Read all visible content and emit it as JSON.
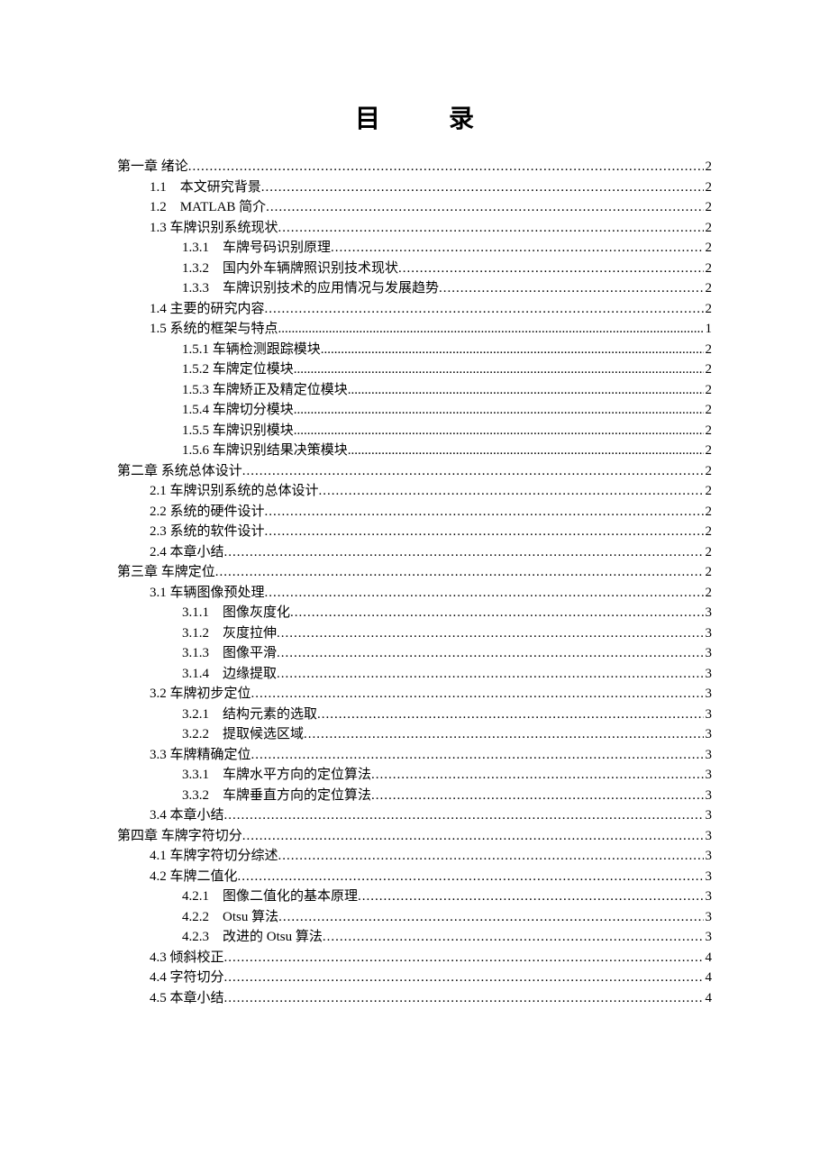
{
  "title": "目　录",
  "entries": [
    {
      "level": 1,
      "label": "第一章  绪论",
      "page": "2",
      "leader": "dots"
    },
    {
      "level": 2,
      "label": "1.1　本文研究背景 ",
      "page": "2",
      "leader": "dots"
    },
    {
      "level": 2,
      "label": "1.2　MATLAB 简介",
      "page": "2",
      "leader": "dots"
    },
    {
      "level": 2,
      "label": "1.3 车牌识别系统现状 ",
      "page": "2",
      "leader": "dots"
    },
    {
      "level": 3,
      "label": "1.3.1　车牌号码识别原理",
      "page": "2",
      "leader": "dots"
    },
    {
      "level": 3,
      "label": "1.3.2　国内外车辆牌照识别技术现状",
      "page": "2",
      "leader": "dots"
    },
    {
      "level": 3,
      "label": "1.3.3　车牌识别技术的应用情况与发展趋势",
      "page": "2",
      "leader": "dots"
    },
    {
      "level": 2,
      "label": "1.4 主要的研究内容 ",
      "page": "2",
      "leader": "dots"
    },
    {
      "level": 2,
      "label": "1.5  系统的框架与特点",
      "page": "1",
      "leader": "thin"
    },
    {
      "level": 3,
      "label": "1.5.1 车辆检测跟踪模块",
      "page": "2",
      "leader": "thin"
    },
    {
      "level": 3,
      "label": "1.5.2 车牌定位模块",
      "page": "2",
      "leader": "thin"
    },
    {
      "level": 3,
      "label": "1.5.3  车牌矫正及精定位模块",
      "page": "2",
      "leader": "thin"
    },
    {
      "level": 3,
      "label": "1.5.4 车牌切分模块",
      "page": "2",
      "leader": "thin"
    },
    {
      "level": 3,
      "label": "1.5.5 车牌识别模块",
      "page": "2",
      "leader": "thin"
    },
    {
      "level": 3,
      "label": "1.5.6 车牌识别结果决策模块",
      "page": "2",
      "leader": "thin"
    },
    {
      "level": 1,
      "label": "第二章  系统总体设计",
      "page": "2",
      "leader": "dots"
    },
    {
      "level": 2,
      "label": "2.1 车牌识别系统的总体设计 ",
      "page": "2",
      "leader": "dots"
    },
    {
      "level": 2,
      "label": "2.2 系统的硬件设计 ",
      "page": "2",
      "leader": "dots"
    },
    {
      "level": 2,
      "label": "2.3 系统的软件设计 ",
      "page": "2",
      "leader": "dots"
    },
    {
      "level": 2,
      "label": "2.4 本章小结 ",
      "page": "2",
      "leader": "dots"
    },
    {
      "level": 1,
      "label": "第三章  车牌定位",
      "page": "2",
      "leader": "dots"
    },
    {
      "level": 2,
      "label": "3.1 车辆图像预处理 ",
      "page": "2",
      "leader": "dots"
    },
    {
      "level": 3,
      "label": "3.1.1　图像灰度化",
      "page": "3",
      "leader": "dots"
    },
    {
      "level": 3,
      "label": "3.1.2　灰度拉伸",
      "page": "3",
      "leader": "dots"
    },
    {
      "level": 3,
      "label": "3.1.3　图像平滑",
      "page": "3",
      "leader": "dots"
    },
    {
      "level": 3,
      "label": "3.1.4　边缘提取",
      "page": "3",
      "leader": "dots"
    },
    {
      "level": 2,
      "label": "3.2 车牌初步定位 ",
      "page": "3",
      "leader": "dots"
    },
    {
      "level": 3,
      "label": "3.2.1　结构元素的选取",
      "page": "3",
      "leader": "dots"
    },
    {
      "level": 3,
      "label": "3.2.2　提取候选区域",
      "page": "3",
      "leader": "dots"
    },
    {
      "level": 2,
      "label": "3.3 车牌精确定位 ",
      "page": "3",
      "leader": "dots"
    },
    {
      "level": 3,
      "label": "3.3.1　车牌水平方向的定位算法",
      "page": "3",
      "leader": "dots"
    },
    {
      "level": 3,
      "label": "3.3.2　车牌垂直方向的定位算法",
      "page": "3",
      "leader": "dots"
    },
    {
      "level": 2,
      "label": "3.4 本章小结 ",
      "page": "3",
      "leader": "dots"
    },
    {
      "level": 1,
      "label": "第四章  车牌字符切分",
      "page": "3",
      "leader": "dots"
    },
    {
      "level": 2,
      "label": "4.1 车牌字符切分综述 ",
      "page": "3",
      "leader": "dots"
    },
    {
      "level": 2,
      "label": "4.2 车牌二值化 ",
      "page": "3",
      "leader": "dots"
    },
    {
      "level": 3,
      "label": "4.2.1　图像二值化的基本原理",
      "page": "3",
      "leader": "dots"
    },
    {
      "level": 3,
      "label": "4.2.2　Otsu 算法",
      "page": "3",
      "leader": "dots"
    },
    {
      "level": 3,
      "label": "4.2.3　改进的 Otsu 算法",
      "page": "3",
      "leader": "dots"
    },
    {
      "level": 2,
      "label": "4.3 倾斜校正 ",
      "page": "4",
      "leader": "dots"
    },
    {
      "level": 2,
      "label": "4.4 字符切分 ",
      "page": "4",
      "leader": "dots"
    },
    {
      "level": 2,
      "label": "4.5 本章小结 ",
      "page": "4",
      "leader": "dots"
    }
  ]
}
